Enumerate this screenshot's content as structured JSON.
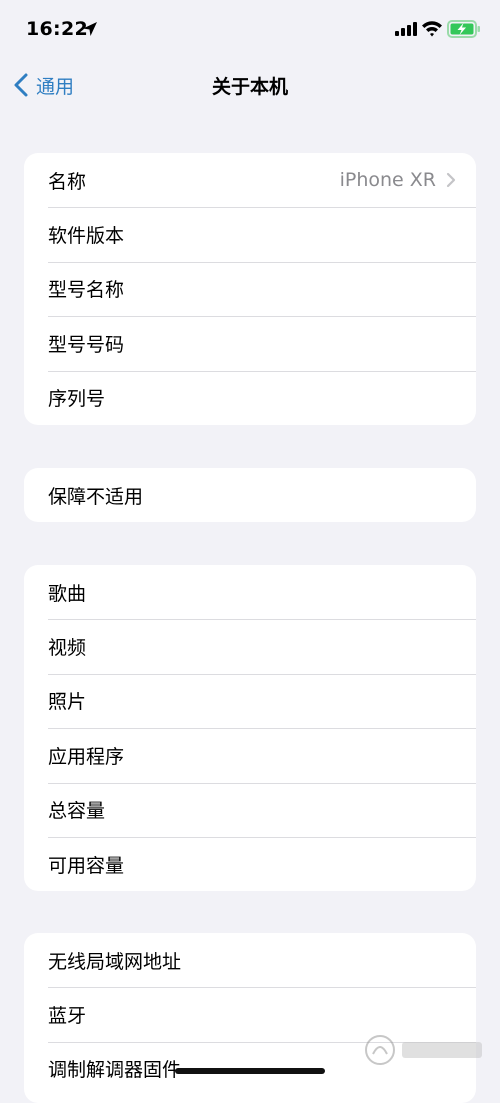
{
  "status_bar": {
    "time": "16:22",
    "icons": [
      "location-arrow-icon",
      "cellular-signal-icon",
      "wifi-icon",
      "battery-charging-icon"
    ]
  },
  "nav": {
    "back_label": "通用",
    "title": "关于本机"
  },
  "groups": [
    {
      "rows": [
        {
          "label": "名称",
          "value": "iPhone XR",
          "chevron": true
        },
        {
          "label": "软件版本",
          "value": ""
        },
        {
          "label": "型号名称",
          "value": ""
        },
        {
          "label": "型号号码",
          "value": ""
        },
        {
          "label": "序列号",
          "value": ""
        }
      ]
    },
    {
      "rows": [
        {
          "label": "保障不适用",
          "value": ""
        }
      ]
    },
    {
      "rows": [
        {
          "label": "歌曲",
          "value": ""
        },
        {
          "label": "视频",
          "value": ""
        },
        {
          "label": "照片",
          "value": ""
        },
        {
          "label": "应用程序",
          "value": ""
        },
        {
          "label": "总容量",
          "value": ""
        },
        {
          "label": "可用容量",
          "value": ""
        }
      ]
    },
    {
      "rows": [
        {
          "label": "无线局域网地址",
          "value": ""
        },
        {
          "label": "蓝牙",
          "value": ""
        },
        {
          "label": "调制解调器固件",
          "value": ""
        }
      ]
    }
  ],
  "colors": {
    "background": "#f2f2f7",
    "accent": "#2f7ec2",
    "secondary_text": "#8a8a8e",
    "battery_green": "#34c759"
  }
}
